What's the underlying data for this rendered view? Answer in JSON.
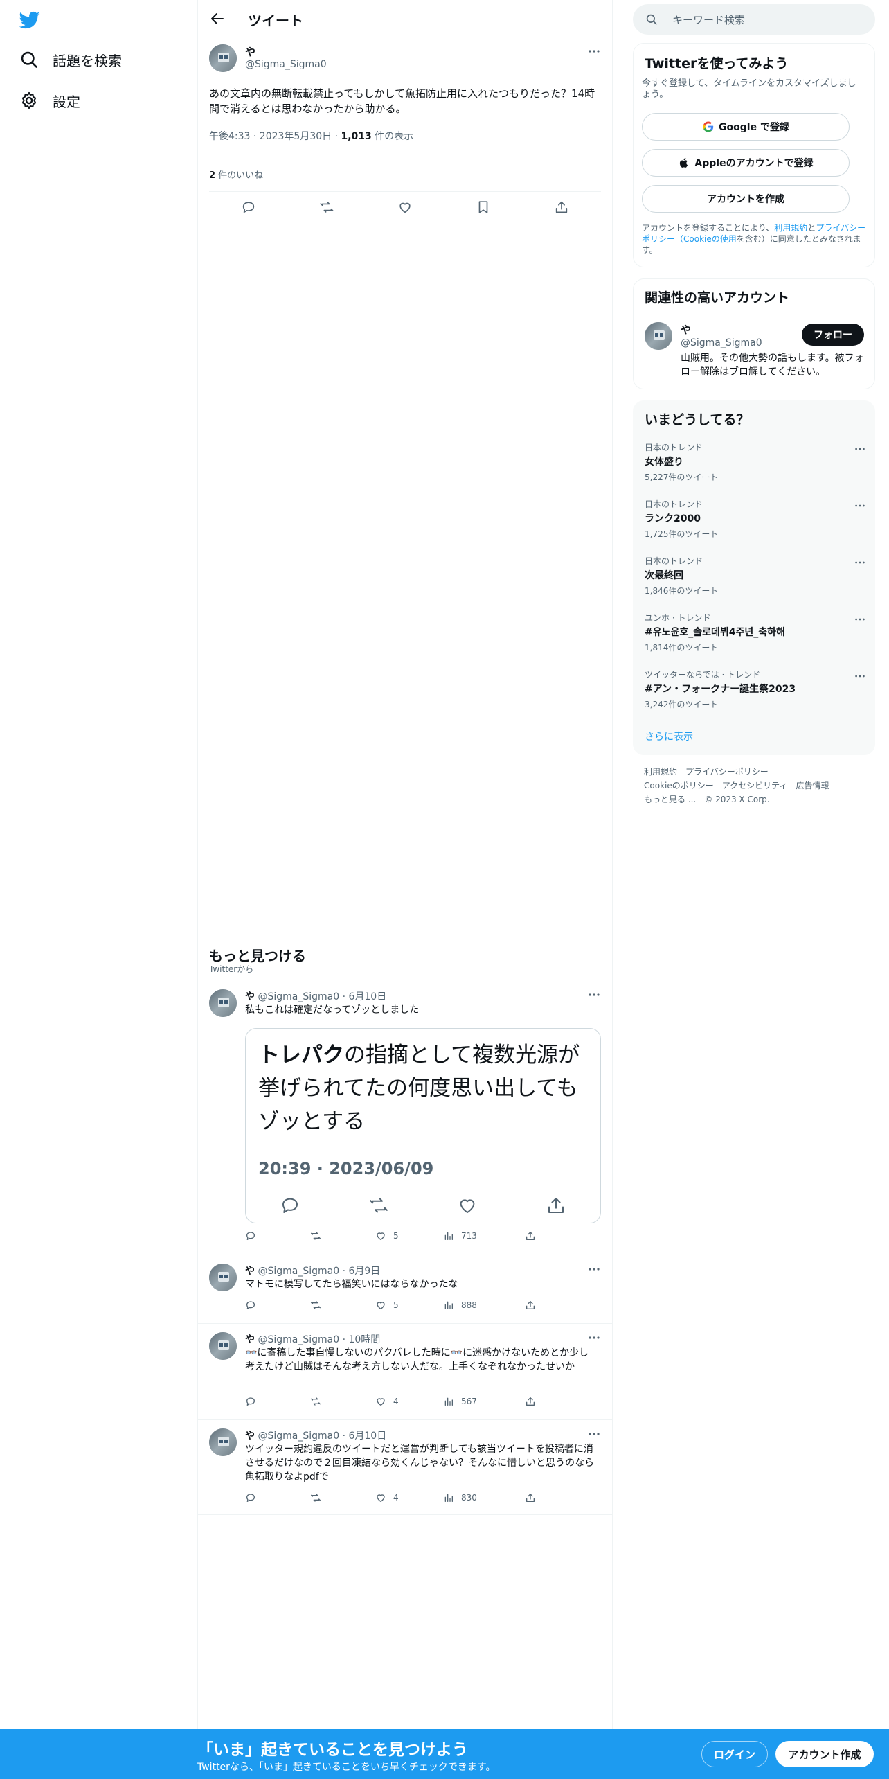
{
  "nav": {
    "items": [
      {
        "label": "話題を検索",
        "icon": "search-icon"
      },
      {
        "label": "設定",
        "icon": "gear-icon"
      }
    ]
  },
  "header": {
    "title": "ツイート"
  },
  "main_tweet": {
    "name": "や",
    "handle": "@Sigma_Sigma0",
    "text": "あの文章内の無断転載禁止ってもしかして魚拓防止用に入れたつもりだった？14時間で消えるとは思わなかったから助かる。",
    "time": "午後4:33 · 2023年5月30日 · ",
    "views_count": "1,013",
    "views_label": " 件の表示",
    "likes_count": "2",
    "likes_label": " 件のいいね"
  },
  "discover": {
    "title": "もっと見つける",
    "subtitle": "Twitterから"
  },
  "feed": [
    {
      "name": "や",
      "handle": "@Sigma_Sigma0 · 6月10日",
      "text": "私もこれは確定だなってゾッとしました",
      "embed": {
        "bold": "トレパク",
        "text": "の指摘として複数光源が挙げられてたの何度思い出してもゾッとする",
        "date": "20:39 · 2023/06/09"
      },
      "likes": "5",
      "views": "713"
    },
    {
      "name": "や",
      "handle": "@Sigma_Sigma0 · 6月9日",
      "text": "マトモに模写してたら福笑いにはならなかったな",
      "likes": "5",
      "views": "888"
    },
    {
      "name": "や",
      "handle": "@Sigma_Sigma0 · 10時間",
      "text": "👓に寄稿した事自慢しないのパクバレした時に👓に迷惑かけないためとか少し考えたけど山賊はそんな考え方しない人だな。上手くなぞれなかったせいか",
      "likes": "4",
      "views": "567"
    },
    {
      "name": "や",
      "handle": "@Sigma_Sigma0 · 6月10日",
      "text": "ツイッター規約違反のツイートだと運営が判断しても該当ツイートを投稿者に消させるだけなので２回目凍結なら効くんじゃない？そんなに惜しいと思うのなら魚拓取りなよpdfで",
      "likes": "4",
      "views": "830"
    }
  ],
  "search": {
    "placeholder": "キーワード検索"
  },
  "signup_card": {
    "title": "Twitterを使ってみよう",
    "subtitle": "今すぐ登録して、タイムラインをカスタマイズしましょう。",
    "google": "Google で登録",
    "apple": "Appleのアカウントで登録",
    "create": "アカウントを作成",
    "legal_1": "アカウントを登録することにより、",
    "legal_terms": "利用規約",
    "legal_2": "と",
    "legal_privacy": "プライバシーポリシー（Cookieの使用",
    "legal_3": "を含む）に同意したとみなされます。"
  },
  "related": {
    "title": "関連性の高いアカウント",
    "name": "や",
    "handle": "@Sigma_Sigma0",
    "follow": "フォロー",
    "bio": "山賊用。その他大勢の話もします。被フォロー解除はブロ解してください。"
  },
  "trends": {
    "title": "いまどうしてる？",
    "items": [
      {
        "context": "日本のトレンド",
        "title": "女体盛り",
        "count": "5,227件のツイート"
      },
      {
        "context": "日本のトレンド",
        "title": "ランク2000",
        "count": "1,725件のツイート"
      },
      {
        "context": "日本のトレンド",
        "title": "次最終回",
        "count": "1,846件のツイート"
      },
      {
        "context": "ユンホ · トレンド",
        "title": "#유노윤호_솔로데뷔4주년_축하해",
        "count": "1,814件のツイート"
      },
      {
        "context": "ツイッターならでは · トレンド",
        "title": "#アン・フォークナー誕生祭2023",
        "count": "3,242件のツイート"
      }
    ],
    "show_more": "さらに表示"
  },
  "footer": {
    "terms": "利用規約",
    "privacy": "プライバシーポリシー",
    "cookie": "Cookieのポリシー",
    "access": "アクセシビリティ",
    "ads": "広告情報",
    "more": "もっと見る ...",
    "copyright": "© 2023 X Corp."
  },
  "bottom": {
    "title": "「いま」起きていることを見つけよう",
    "subtitle": "Twitterなら、「いま」起きていることをいち早くチェックできます。",
    "login": "ログイン",
    "signup": "アカウント作成"
  },
  "colors": {
    "accent": "#1d9bf0",
    "text": "#0f1419",
    "muted": "#536471",
    "border": "#eff3f4"
  }
}
